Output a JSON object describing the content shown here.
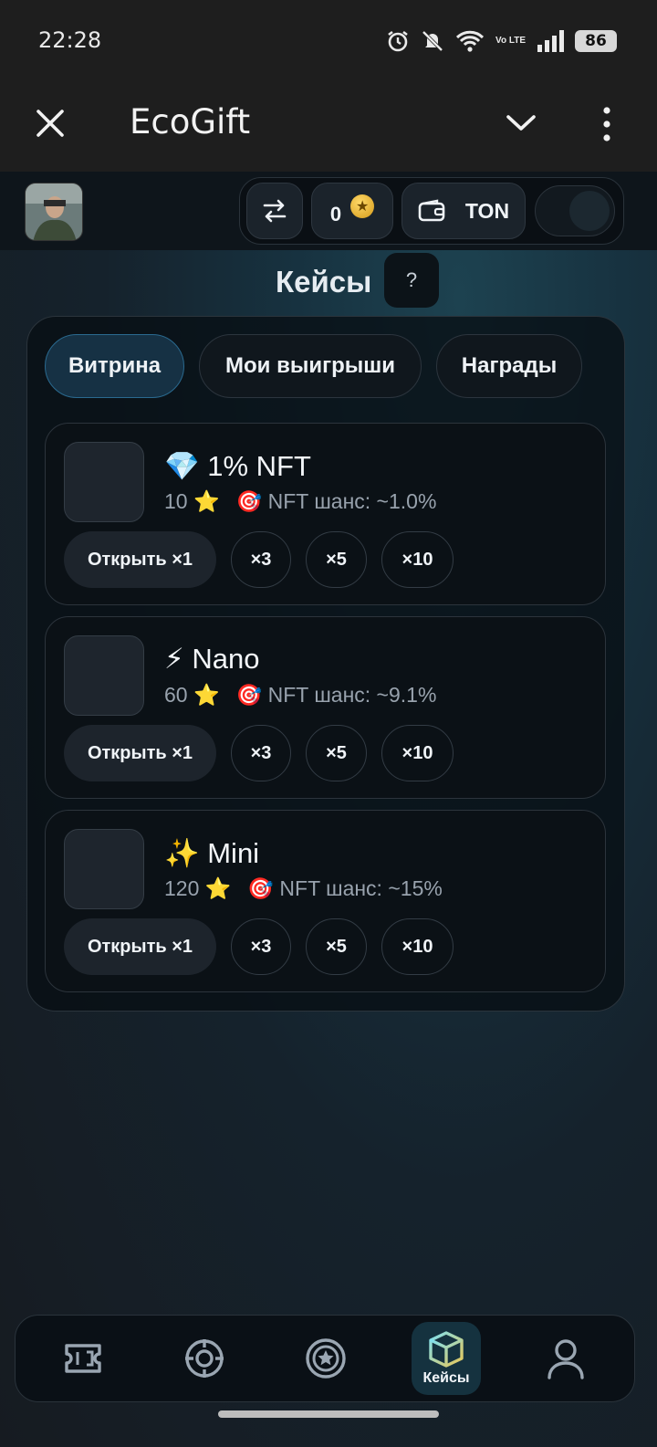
{
  "status_bar": {
    "time": "22:28",
    "battery": "86",
    "network_label": "Vo LTE",
    "icons": [
      "alarm-icon",
      "mute-icon",
      "wifi-icon",
      "volte-icon",
      "signal-icon",
      "battery-icon"
    ]
  },
  "app_bar": {
    "title": "EcoGift",
    "icons": [
      "close-icon",
      "chevron-down-icon",
      "more-vert-icon"
    ]
  },
  "header": {
    "balance": "0",
    "wallet_label": "TON",
    "toggle_on": false,
    "icons": [
      "swap-icon",
      "coin-icon",
      "wallet-icon"
    ]
  },
  "page": {
    "title": "Кейсы",
    "help_label": "?"
  },
  "tabs": [
    {
      "label": "Витрина",
      "active": true
    },
    {
      "label": "Мои выигрыши",
      "active": false
    },
    {
      "label": "Награды",
      "active": false
    }
  ],
  "cases": [
    {
      "emoji": "💎",
      "name": "1% NFT",
      "price": "10 ⭐",
      "chance": "🎯 NFT шанс: ~1.0%"
    },
    {
      "emoji": "⚡",
      "name": "Nano",
      "price": "60 ⭐",
      "chance": "🎯 NFT шанс: ~9.1%"
    },
    {
      "emoji": "✨",
      "name": "Mini",
      "price": "120 ⭐",
      "chance": "🎯 NFT шанс: ~15%"
    }
  ],
  "case_buttons": {
    "open": "Открыть ×1",
    "x3": "×3",
    "x5": "×5",
    "x10": "×10"
  },
  "bottom_nav": {
    "active_label": "Кейсы",
    "items": [
      "ticket-icon",
      "target-icon",
      "star-badge-icon",
      "box-icon",
      "profile-icon"
    ]
  },
  "colors": {
    "accent": "#2a6a90",
    "background": "#141a20",
    "card": "#0b1116"
  }
}
